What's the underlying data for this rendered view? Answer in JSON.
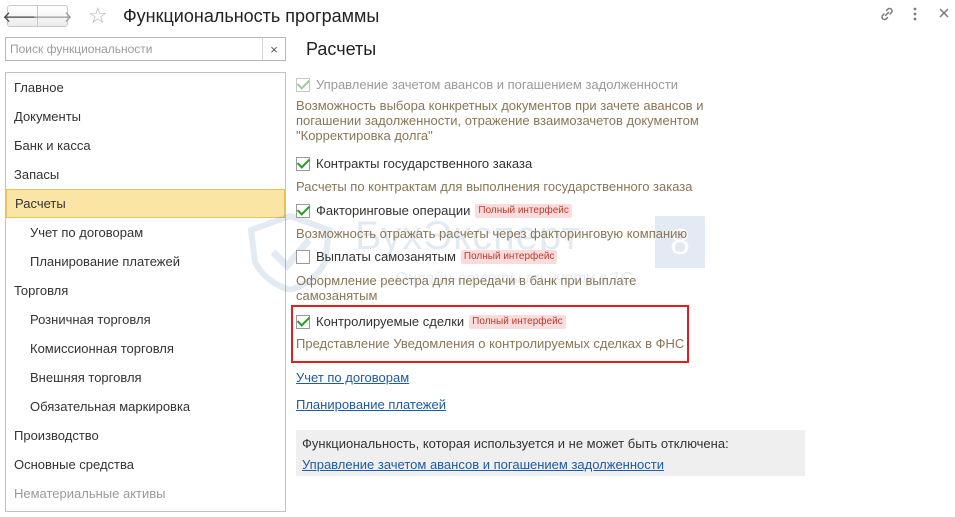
{
  "window": {
    "title": "Функциональность программы",
    "back_icon": "arrow-left-icon",
    "forward_icon": "arrow-right-icon",
    "favorite_icon": "star-icon"
  },
  "search": {
    "placeholder": "Поиск функциональности",
    "value": "",
    "clear_label": "×"
  },
  "sidebar": {
    "items": [
      {
        "label": "Главное",
        "level": 1
      },
      {
        "label": "Документы",
        "level": 1
      },
      {
        "label": "Банк и касса",
        "level": 1
      },
      {
        "label": "Запасы",
        "level": 1
      },
      {
        "label": "Расчеты",
        "level": 1,
        "active": true
      },
      {
        "label": "Учет по договорам",
        "level": 2
      },
      {
        "label": "Планирование платежей",
        "level": 2
      },
      {
        "label": "Торговля",
        "level": 1
      },
      {
        "label": "Розничная торговля",
        "level": 2
      },
      {
        "label": "Комиссионная торговля",
        "level": 2
      },
      {
        "label": "Внешняя торговля",
        "level": 2
      },
      {
        "label": "Обязательная маркировка",
        "level": 2
      },
      {
        "label": "Производство",
        "level": 1
      },
      {
        "label": "Основные средства",
        "level": 1
      },
      {
        "label": "Нематериальные активы",
        "level": 1
      }
    ]
  },
  "main": {
    "title": "Расчеты",
    "options": [
      {
        "label": "Управление зачетом авансов и погашением задолженности",
        "checked": true,
        "disabled": true,
        "badge": "",
        "description": "Возможность выбора конкретных документов при зачете авансов и погашении задолженности, отражение взаимозачетов документом \"Корректировка долга\""
      },
      {
        "label": "Контракты государственного заказа",
        "checked": true,
        "disabled": false,
        "badge": "",
        "description": "Расчеты по контрактам для выполнения государственного заказа"
      },
      {
        "label": "Факторинговые операции",
        "checked": true,
        "disabled": false,
        "badge": "Полный интерфейс",
        "description": "Возможность отражать расчеты через факторинговую компанию"
      },
      {
        "label": "Выплаты самозанятым",
        "checked": false,
        "disabled": false,
        "badge": "Полный интерфейс",
        "description": "Оформление реестра для передачи в банк при выплате самозанятым"
      },
      {
        "label": "Контролируемые сделки",
        "checked": true,
        "disabled": false,
        "badge": "Полный интерфейс",
        "description": "Представление Уведомления о контролируемых сделках в ФНС"
      }
    ],
    "links": [
      "Учет по договорам",
      "Планирование платежей"
    ],
    "info_panel": {
      "text": "Функциональность, которая используется и не может быть отключена:",
      "link": "Управление зачетом авансов и погашением задолженности"
    }
  },
  "watermark": {
    "brand": "БухЭксперт",
    "badge": "8",
    "sub": "Онлайн-ответы по учету в 1С"
  },
  "colors": {
    "accent_link": "#1c5ba6",
    "active_item": "#fbe5a4",
    "description_text": "#8a7556",
    "badge_bg": "#fbdcdc",
    "badge_text": "#c0392b",
    "highlight": "#e02020",
    "check": "#2b9b2b"
  }
}
